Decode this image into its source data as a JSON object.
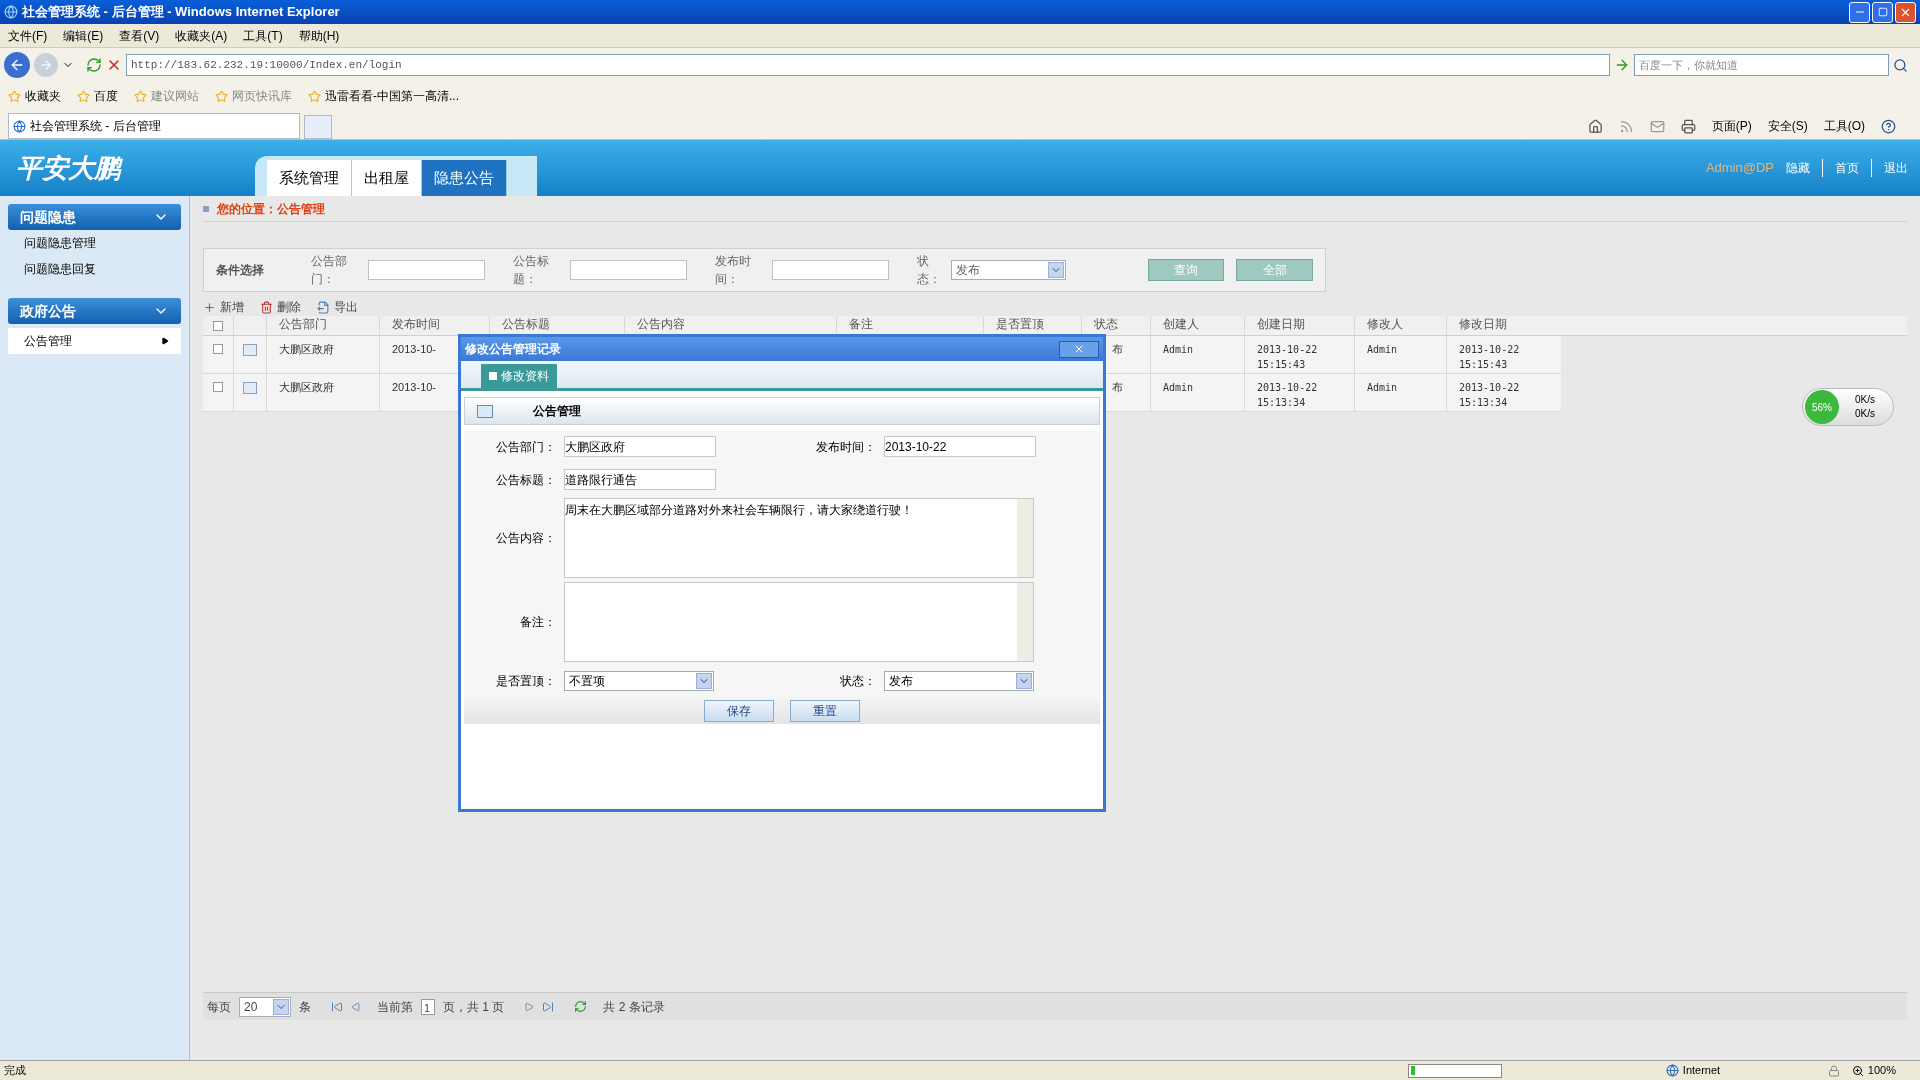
{
  "window": {
    "title": "社会管理系统 - 后台管理 - Windows Internet Explorer"
  },
  "menu": [
    "文件(F)",
    "编辑(E)",
    "查看(V)",
    "收藏夹(A)",
    "工具(T)",
    "帮助(H)"
  ],
  "address": {
    "url": "http://183.62.232.19:10000/Index.en/login",
    "search_placeholder": "百度一下，你就知道"
  },
  "favorites": [
    "收藏夹",
    "百度",
    "建议网站",
    "网页快讯库",
    "迅雷看看-中国第一高清..."
  ],
  "browser_tab": {
    "title": "社会管理系统 - 后台管理"
  },
  "command_bar": [
    "页面(P)",
    "安全(S)",
    "工具(O)"
  ],
  "app": {
    "logo": "平安大鹏",
    "nav_tabs": [
      {
        "label": "系统管理",
        "selected": false
      },
      {
        "label": "出租屋",
        "selected": false
      },
      {
        "label": "隐患公告",
        "selected": true
      }
    ],
    "user": "Admin@DP",
    "links": [
      "隐藏",
      "首页",
      "退出"
    ]
  },
  "sidebar": [
    {
      "title": "问题隐患",
      "items": [
        {
          "label": "问题隐患管理",
          "selected": false
        },
        {
          "label": "问题隐患回复",
          "selected": false
        }
      ]
    },
    {
      "title": "政府公告",
      "items": [
        {
          "label": "公告管理",
          "selected": true
        }
      ]
    }
  ],
  "breadcrumb": "您的位置：公告管理",
  "filter": {
    "title": "条件选择",
    "fields": [
      {
        "label": "公告部门：",
        "kind": "text"
      },
      {
        "label": "公告标题：",
        "kind": "text"
      },
      {
        "label": "发布时间：",
        "kind": "text"
      },
      {
        "label": "状态：",
        "kind": "select",
        "value": "发布"
      }
    ],
    "buttons": [
      "查询",
      "全部"
    ]
  },
  "toolbar": [
    "新增",
    "删除",
    "导出"
  ],
  "table": {
    "select_all_checked": false,
    "columns": [
      "公告部门",
      "发布时间",
      "公告标题",
      "公告内容",
      "备注",
      "是否置顶",
      "状态",
      "创建人",
      "创建日期",
      "修改人",
      "修改日期"
    ],
    "rows": [
      {
        "checked": false,
        "cells": [
          "大鹏区政府",
          "2013-10-",
          null,
          null,
          null,
          null,
          "布",
          "Admin",
          "2013-10-22 15:15:43",
          "Admin",
          "2013-10-22 15:15:43"
        ]
      },
      {
        "checked": false,
        "cells": [
          "大鹏区政府",
          "2013-10-",
          null,
          null,
          null,
          null,
          "布",
          "Admin",
          "2013-10-22 15:13:34",
          "Admin",
          "2013-10-22 15:13:34"
        ]
      }
    ]
  },
  "pager": {
    "per_page_label": "每页",
    "per_page": "20",
    "unit": "条",
    "current_label": "当前第",
    "page": "1",
    "total_pages": "页，共 1 页",
    "records": "共 2 条记录"
  },
  "dialog": {
    "title": "修改公告管理记录",
    "tab": "修改资料",
    "section": "公告管理",
    "dept_label": "公告部门：",
    "dept": "大鹏区政府",
    "date_label": "发布时间：",
    "date": "2013-10-22",
    "title_label": "公告标题：",
    "title_value": "道路限行通告",
    "content_label": "公告内容：",
    "content": "周末在大鹏区域部分道路对外来社会车辆限行，请大家绕道行驶！",
    "note_label": "备注：",
    "top_label": "是否置顶：",
    "top": "不置项",
    "status_label": "状态：",
    "status": "发布",
    "buttons": [
      "保存",
      "重置"
    ]
  },
  "net_widget": {
    "percent": "56%",
    "up": "0K/s",
    "down": "0K/s"
  },
  "status_bar": {
    "progress": {
      "level": 0.05
    },
    "text": "完成",
    "zone": "Internet",
    "zoom": "100%"
  }
}
